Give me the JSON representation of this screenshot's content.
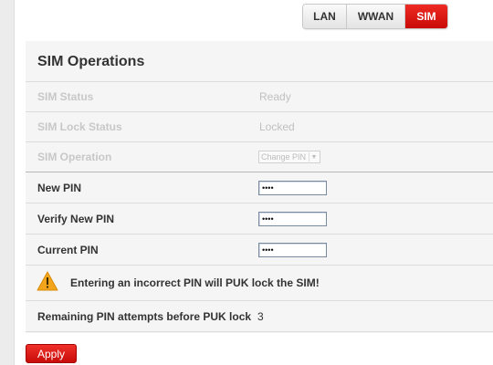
{
  "tabs": [
    {
      "label": "LAN",
      "active": false
    },
    {
      "label": "WWAN",
      "active": false
    },
    {
      "label": "SIM",
      "active": true
    }
  ],
  "section": {
    "title": "SIM Operations"
  },
  "rows": {
    "sim_status": {
      "label": "SIM Status",
      "value": "Ready"
    },
    "sim_lock_status": {
      "label": "SIM Lock Status",
      "value": "Locked"
    },
    "sim_operation": {
      "label": "SIM Operation",
      "selected": "Change PIN"
    },
    "new_pin": {
      "label": "New PIN",
      "value": "••••"
    },
    "verify_new_pin": {
      "label": "Verify New PIN",
      "value": "••••"
    },
    "current_pin": {
      "label": "Current PIN",
      "value": "••••"
    }
  },
  "warning": {
    "icon": "warning-triangle-icon",
    "text": "Entering an incorrect PIN will PUK lock the SIM!"
  },
  "remaining": {
    "label": "Remaining PIN attempts before PUK lock",
    "value": "3"
  },
  "apply": {
    "label": "Apply"
  },
  "colors": {
    "accent": "#d9140f",
    "warning": "#f2a51a",
    "panel_bg": "#f5f5f5"
  }
}
